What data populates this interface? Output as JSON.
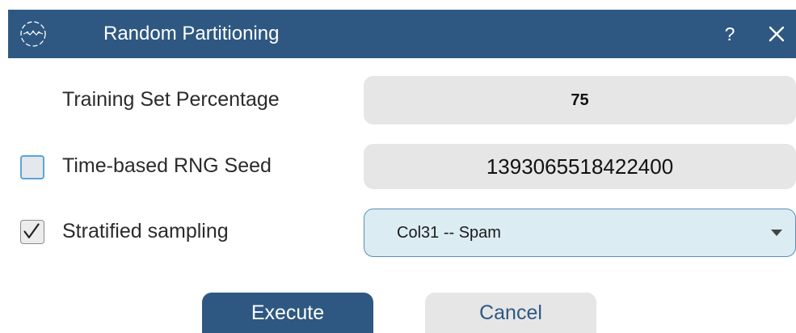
{
  "dialog": {
    "title": "Random Partitioning",
    "help_label": "?",
    "close_icon": "close-icon",
    "logo_icon": "app-logo-icon"
  },
  "training_set": {
    "label": "Training Set Percentage",
    "value": "75"
  },
  "rng_seed": {
    "label": "Time-based RNG Seed",
    "checked": false,
    "value": "1393065518422400"
  },
  "stratified": {
    "label": "Stratified sampling",
    "checked": true,
    "selected": "Col31 -- Spam"
  },
  "buttons": {
    "execute": "Execute",
    "cancel": "Cancel"
  },
  "colors": {
    "titlebar": "#2e5882",
    "select_bg": "#dcecf3",
    "field_bg": "#e6e6e6"
  }
}
